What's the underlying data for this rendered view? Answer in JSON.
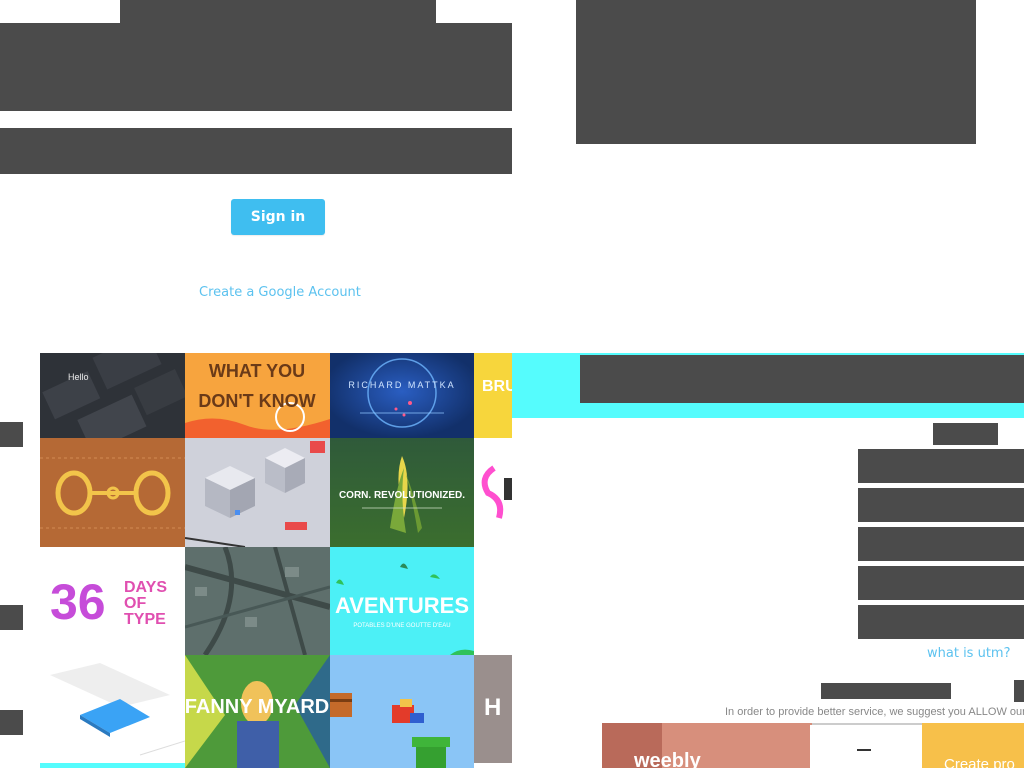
{
  "login": {
    "signin_label": "Sign in",
    "create_account_label": "Create a Google Account"
  },
  "gallery": {
    "tiles": [
      {
        "name": "tile-hello-ui",
        "text": "Hello"
      },
      {
        "name": "tile-what-you-dont-know",
        "text": "WHAT YOU DON'T KNOW"
      },
      {
        "name": "tile-richard-mattka",
        "text": "RICHARD MATTKA"
      },
      {
        "name": "tile-partial-yellow",
        "text": "BRU"
      },
      {
        "name": "tile-gold-horsebit",
        "text": ""
      },
      {
        "name": "tile-isometric-city",
        "text": ""
      },
      {
        "name": "tile-corn-revolutionized",
        "text": "CORN. REVOLUTIONIZED."
      },
      {
        "name": "tile-partial-pink",
        "text": ""
      },
      {
        "name": "tile-36-days-of-type",
        "text": "36 DAYS OF TYPE"
      },
      {
        "name": "tile-3d-map",
        "text": ""
      },
      {
        "name": "tile-aventures",
        "text": "AVENTURES"
      },
      {
        "name": "tile-blue-card",
        "text": ""
      },
      {
        "name": "tile-fanny-myard",
        "text": "FANNY MYARD"
      },
      {
        "name": "tile-mario-pipe",
        "text": ""
      },
      {
        "name": "tile-partial-gray",
        "text": "H"
      }
    ]
  },
  "utm": {
    "what_is_utm_label": "what is utm?",
    "notice_text": "In order to provide better service, we suggest you ALLOW our"
  },
  "banner": {
    "brand": "weebly",
    "cta": "Create pro"
  },
  "colors": {
    "redaction": "#4b4b4b",
    "accent_blue": "#3fbef0",
    "link_blue": "#5cc2ef",
    "cyan_band": "#55fcfd"
  }
}
